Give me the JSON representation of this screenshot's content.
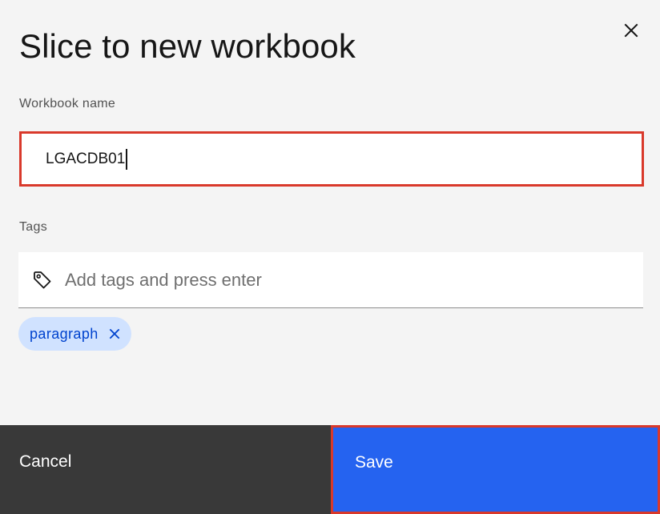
{
  "modal": {
    "title": "Slice to new workbook",
    "close_icon": "close-icon"
  },
  "workbook_name": {
    "label": "Workbook name",
    "value": "LGACDB01"
  },
  "tags": {
    "label": "Tags",
    "placeholder": "Add tags and press enter",
    "icon": "tag-icon",
    "items": [
      {
        "label": "paragraph",
        "remove_icon": "close-icon"
      }
    ]
  },
  "footer": {
    "cancel_label": "Cancel",
    "save_label": "Save"
  },
  "colors": {
    "background": "#f4f4f4",
    "highlight_border": "#d9392b",
    "primary_button": "#2563f0",
    "secondary_button": "#393939",
    "chip_background": "#d0e2ff",
    "chip_text": "#0043ce"
  }
}
